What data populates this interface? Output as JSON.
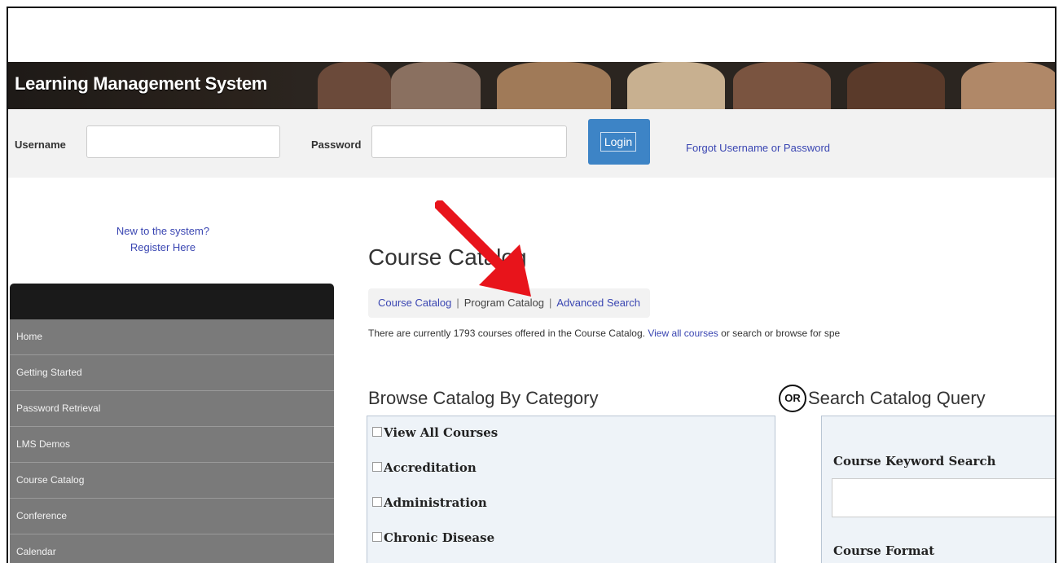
{
  "app": {
    "title": "Learning Management System"
  },
  "login": {
    "username_label": "Username",
    "username_value": "",
    "password_label": "Password",
    "password_value": "",
    "login_label": "Login",
    "forgot_label": "Forgot Username or Password"
  },
  "register": {
    "line1": "New to the system?",
    "line2": "Register Here"
  },
  "sidebar": {
    "items": [
      {
        "label": "Home"
      },
      {
        "label": "Getting Started"
      },
      {
        "label": "Password Retrieval"
      },
      {
        "label": "LMS Demos"
      },
      {
        "label": "Course Catalog"
      },
      {
        "label": "Conference"
      },
      {
        "label": "Calendar"
      }
    ]
  },
  "main": {
    "title": "Course Catalog",
    "tabs": [
      {
        "label": "Course Catalog"
      },
      {
        "label": "Program Catalog"
      },
      {
        "label": "Advanced Search"
      }
    ],
    "tab_separator": "|",
    "intro_text": "There are currently 1793 courses offered in the Course Catalog.",
    "intro_link": "View all courses",
    "intro_tail": "or search or browse for spe",
    "browse_title": "Browse Catalog By Category",
    "categories": [
      {
        "label": "View All Courses"
      },
      {
        "label": "Accreditation"
      },
      {
        "label": "Administration"
      },
      {
        "label": "Chronic Disease"
      }
    ],
    "or_label": "OR",
    "search_title": "Search Catalog Query",
    "keyword_label": "Course Keyword Search",
    "keyword_value": "",
    "format_label": "Course Format"
  },
  "colors": {
    "banner": "#2b2520",
    "login_button": "#3d84c6",
    "link": "#3a46b2",
    "sidebar_item": "#7a7a7a",
    "annotation_arrow": "#e8141b"
  },
  "icons": {
    "annotation": "red-arrow-icon"
  }
}
